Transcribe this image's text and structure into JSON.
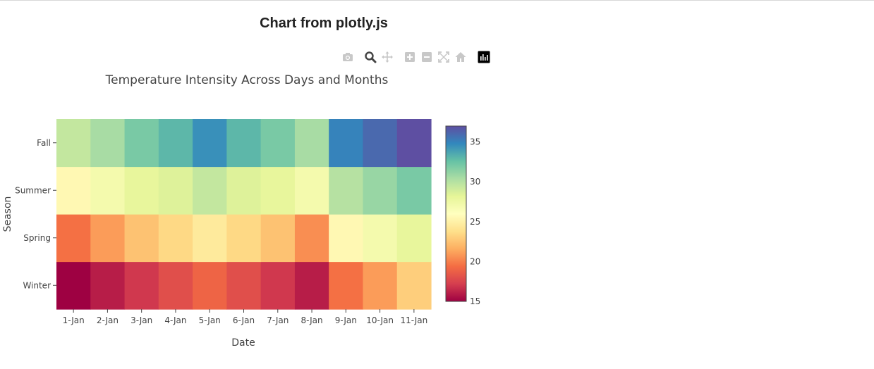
{
  "page": {
    "title": "Chart from plotly.js"
  },
  "modebar": {
    "buttons": [
      {
        "icon": "camera-icon",
        "active": false
      },
      {
        "icon": "zoom-icon",
        "active": true
      },
      {
        "icon": "pan-icon",
        "active": false
      },
      {
        "icon": "zoom-in-icon",
        "active": false
      },
      {
        "icon": "zoom-out-icon",
        "active": false
      },
      {
        "icon": "autoscale-icon",
        "active": false
      },
      {
        "icon": "home-icon",
        "active": false
      },
      {
        "icon": "plotly-logo-icon",
        "active": false
      }
    ],
    "colors": {
      "inactive": "#c8c8c8",
      "active": "#444444",
      "logo": "#000000"
    }
  },
  "chart_data": {
    "type": "heatmap",
    "title": "Temperature Intensity Across Days and Months",
    "xlabel": "Date",
    "ylabel": "Season",
    "x": [
      "1-Jan",
      "2-Jan",
      "3-Jan",
      "4-Jan",
      "5-Jan",
      "6-Jan",
      "7-Jan",
      "8-Jan",
      "9-Jan",
      "10-Jan",
      "11-Jan"
    ],
    "y": [
      "Winter",
      "Spring",
      "Summer",
      "Fall"
    ],
    "z": [
      [
        15,
        16,
        17,
        18,
        19,
        18,
        17,
        16,
        19.5,
        21,
        23
      ],
      [
        19.5,
        21,
        22.5,
        23.5,
        24.5,
        23.5,
        22.5,
        20.5,
        25.5,
        27,
        28
      ],
      [
        25.5,
        27,
        28,
        28.5,
        29.5,
        28.5,
        28,
        27,
        30,
        31,
        32
      ],
      [
        29.5,
        30.5,
        32,
        33,
        34.5,
        33,
        32,
        30.5,
        35,
        36,
        37
      ]
    ],
    "zmin": 15,
    "zmax": 37,
    "colorscale": "Spectral",
    "colorbar": {
      "ticks": [
        "15",
        "20",
        "25",
        "30",
        "35"
      ],
      "tickvals": [
        15,
        20,
        25,
        30,
        35
      ]
    }
  }
}
